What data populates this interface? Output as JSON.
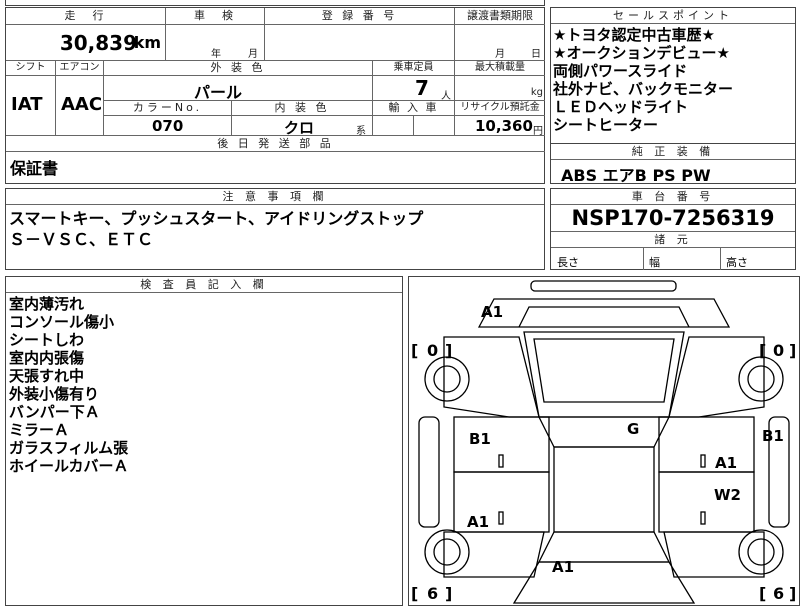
{
  "left_table": {
    "mileage_label": "走　行",
    "shaken_label": "車　検",
    "registration_label": "登 録 番 号",
    "transfer_label": "譲渡書類期限",
    "mileage_value": "30,839",
    "mileage_unit": "km",
    "year_unit": "年",
    "month_unit": "月",
    "transfer_month": "月",
    "transfer_day": "日",
    "shift_label": "シフト",
    "ac_label": "エアコン",
    "exterior_color_label": "外 装 色",
    "capacity_label": "乗車定員",
    "max_load_label": "最大積載量",
    "shift_value": "IAT",
    "ac_value": "AAC",
    "exterior_color_value": "パール",
    "capacity_value": "7",
    "capacity_unit": "人",
    "load_unit": "kg",
    "color_no_label": "カラーNo.",
    "interior_color_label": "内 装 色",
    "import_label": "輸 入 車",
    "recycle_label": "リサイクル預託金",
    "color_no_value": "070",
    "interior_color_value": "クロ",
    "interior_color_suffix": "系",
    "recycle_value": "10,360",
    "recycle_unit": "円",
    "later_parts_label": "後 日 発 送 部 品",
    "later_parts_value": "保証書"
  },
  "sales_points": {
    "label": "セールスポイント",
    "lines": [
      "★トヨタ認定中古車歴★",
      "★オークションデビュー★",
      "両側パワースライド",
      "社外ナビ、バックモニター",
      "ＬＥＤヘッドライト",
      "シートヒーター"
    ]
  },
  "equipment": {
    "label": "純 正 装 備",
    "value": "ABS エアB PS PW"
  },
  "notes": {
    "label": "注 意 事 項 欄",
    "lines": [
      "スマートキー、プッシュスタート、アイドリングストップ",
      "Ｓ－ＶＳＣ、ＥＴＣ"
    ]
  },
  "chassis": {
    "label": "車 台 番 号",
    "value": "NSP170-7256319",
    "dims_label": "諸 元",
    "length_label": "長さ",
    "width_label": "幅",
    "height_label": "高さ"
  },
  "inspector": {
    "label": "検 査 員 記 入 欄",
    "lines": [
      "室内薄汚れ",
      "コンソール傷小",
      "シートしわ",
      "室内内張傷",
      "天張すれ中",
      "外装小傷有り",
      "バンパー下Ａ",
      "ミラーＡ",
      "ガラスフィルム張",
      "ホイールカバーＡ"
    ]
  },
  "diagram": {
    "marks": {
      "front": "A1",
      "left_front": "B1",
      "right_front": "B1",
      "roof": "G",
      "right_front_door": "A1",
      "right_rear_door": "W2",
      "left_rear": "A1",
      "rear": "A1"
    },
    "tires": {
      "front_left": "0",
      "front_right": "0",
      "rear_left": "6",
      "rear_right": "6"
    }
  }
}
